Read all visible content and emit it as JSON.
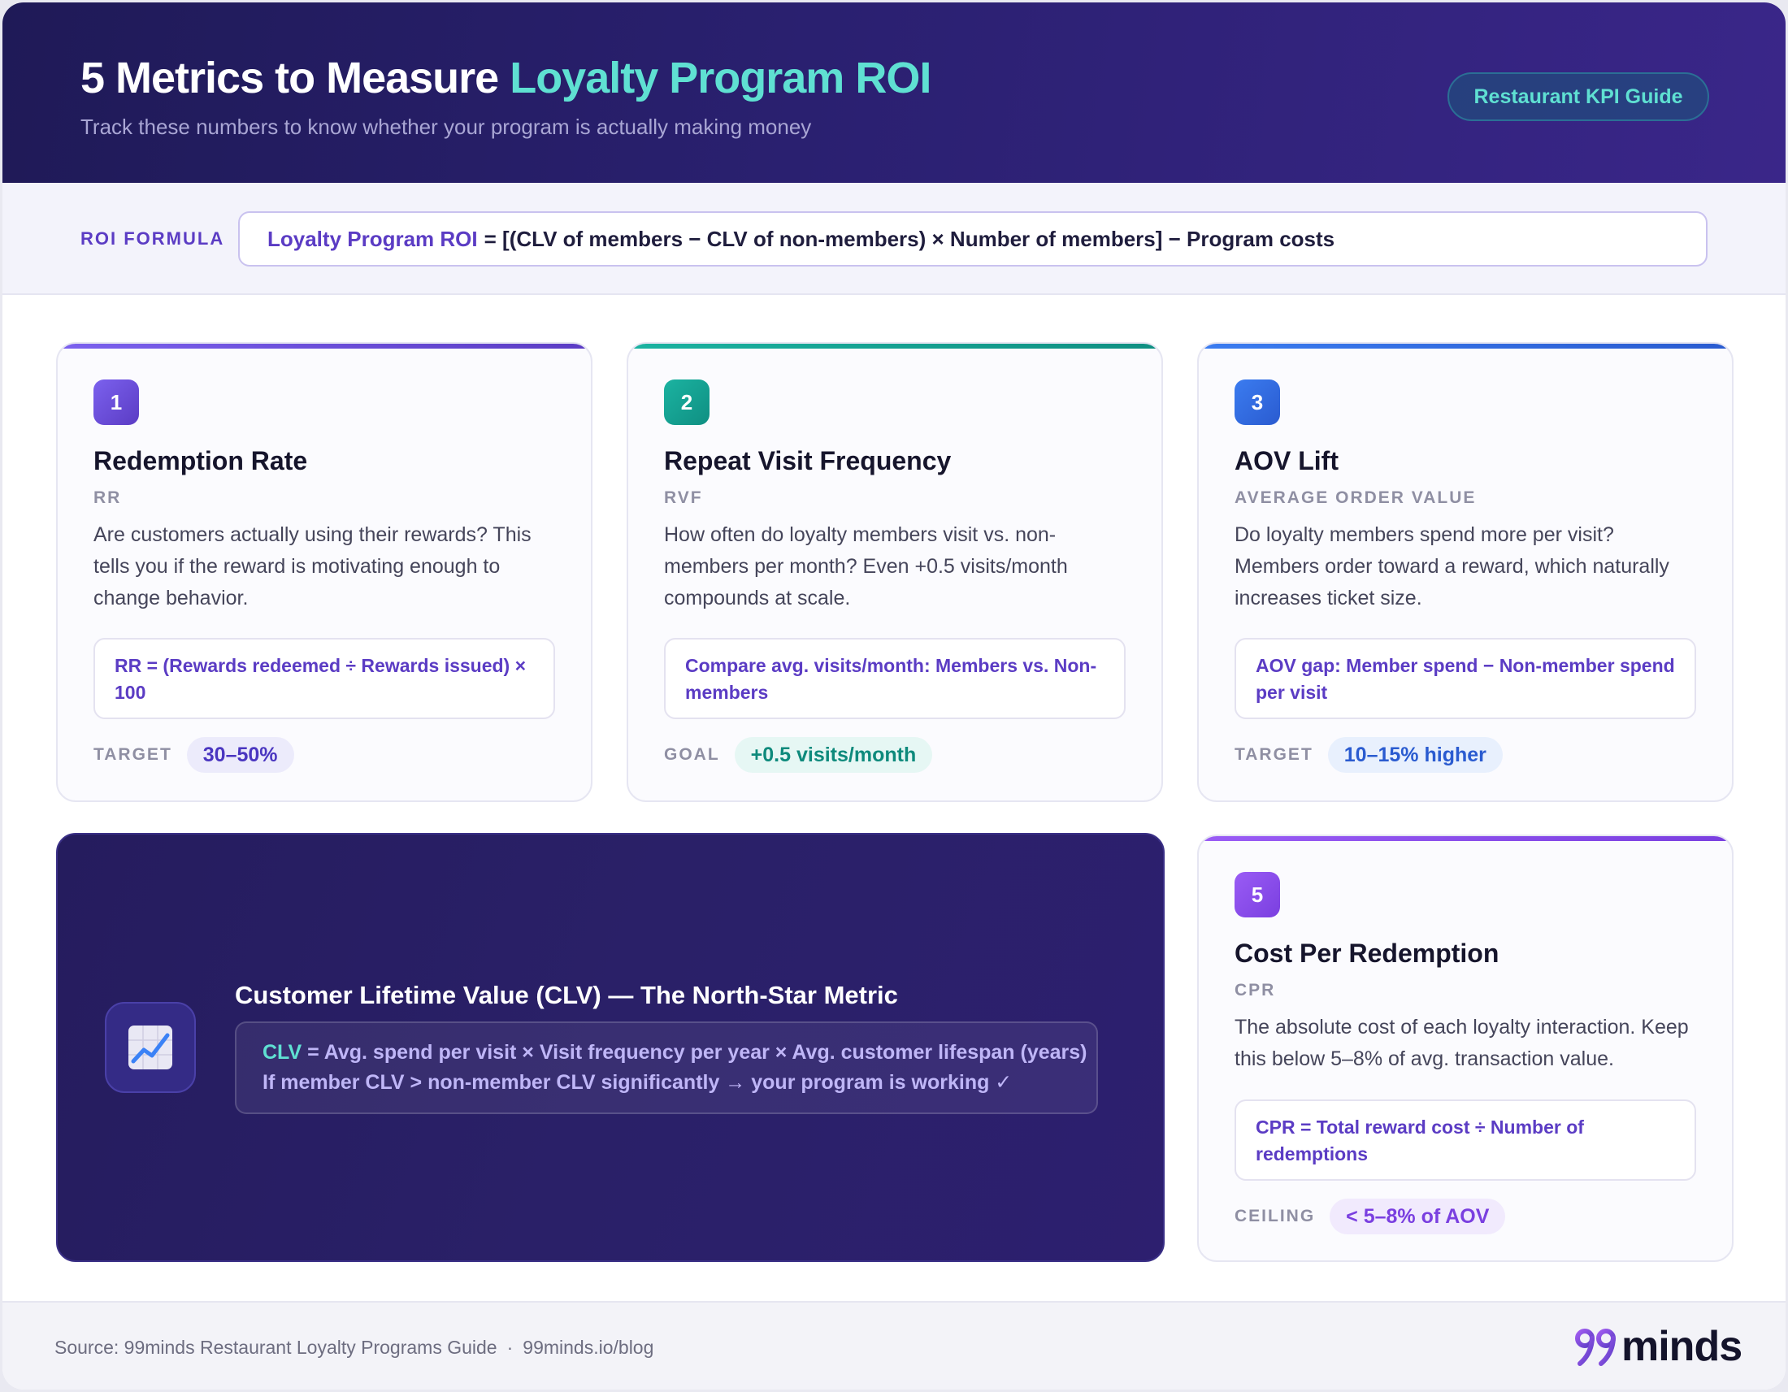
{
  "header": {
    "title_prefix": "5 Metrics to Measure ",
    "title_accent": "Loyalty Program ROI",
    "subtitle": "Track these numbers to know whether your program is actually making money",
    "badge": "Restaurant KPI Guide"
  },
  "roi": {
    "label": "ROI FORMULA",
    "name": "Loyalty Program ROI",
    "expression": "= [(CLV of members − CLV of non-members) × Number of members] − Program costs"
  },
  "metrics": [
    {
      "number": "1",
      "title": "Redemption Rate",
      "abbr": "RR",
      "description": "Are customers actually using their rewards? This tells you if the reward is motivating enough to change behavior.",
      "formula": "RR = (Rewards redeemed ÷ Rewards issued) × 100",
      "target_label": "TARGET",
      "target_value": "30–50%",
      "color": "#6a4fe0"
    },
    {
      "number": "2",
      "title": "Repeat Visit Frequency",
      "abbr": "RVF",
      "description": "How often do loyalty members visit vs. non-members per month? Even +0.5 visits/month compounds at scale.",
      "formula": "Compare avg. visits/month: Members vs. Non-members",
      "target_label": "GOAL",
      "target_value": "+0.5 visits/month",
      "color": "#14a394"
    },
    {
      "number": "3",
      "title": "AOV Lift",
      "abbr": "AVERAGE ORDER VALUE",
      "description": "Do loyalty members spend more per visit? Members order toward a reward, which naturally increases ticket size.",
      "formula": "AOV gap: Member spend − Non-member spend per visit",
      "target_label": "TARGET",
      "target_value": "10–15% higher",
      "color": "#2f6ee0"
    },
    {
      "number": "5",
      "title": "Cost Per Redemption",
      "abbr": "CPR",
      "description": "The absolute cost of each loyalty interaction. Keep this below 5–8% of avg. transaction value.",
      "formula": "CPR = Total reward cost ÷ Number of redemptions",
      "target_label": "CEILING",
      "target_value": "< 5–8% of AOV",
      "color": "#8a4ff0"
    }
  ],
  "clv": {
    "icon": "chart-trend-icon",
    "title": "Customer Lifetime Value (CLV) — The North-Star Metric",
    "key": "CLV",
    "formula": "= Avg. spend per visit × Visit frequency per year × Avg. customer lifespan (years)",
    "note": "If member CLV > non-member CLV significantly → your program is working ✓"
  },
  "footer": {
    "source": "Source: 99minds Restaurant Loyalty Programs Guide",
    "separator": "·",
    "url": "99minds.io/blog",
    "logo_text": "minds"
  }
}
